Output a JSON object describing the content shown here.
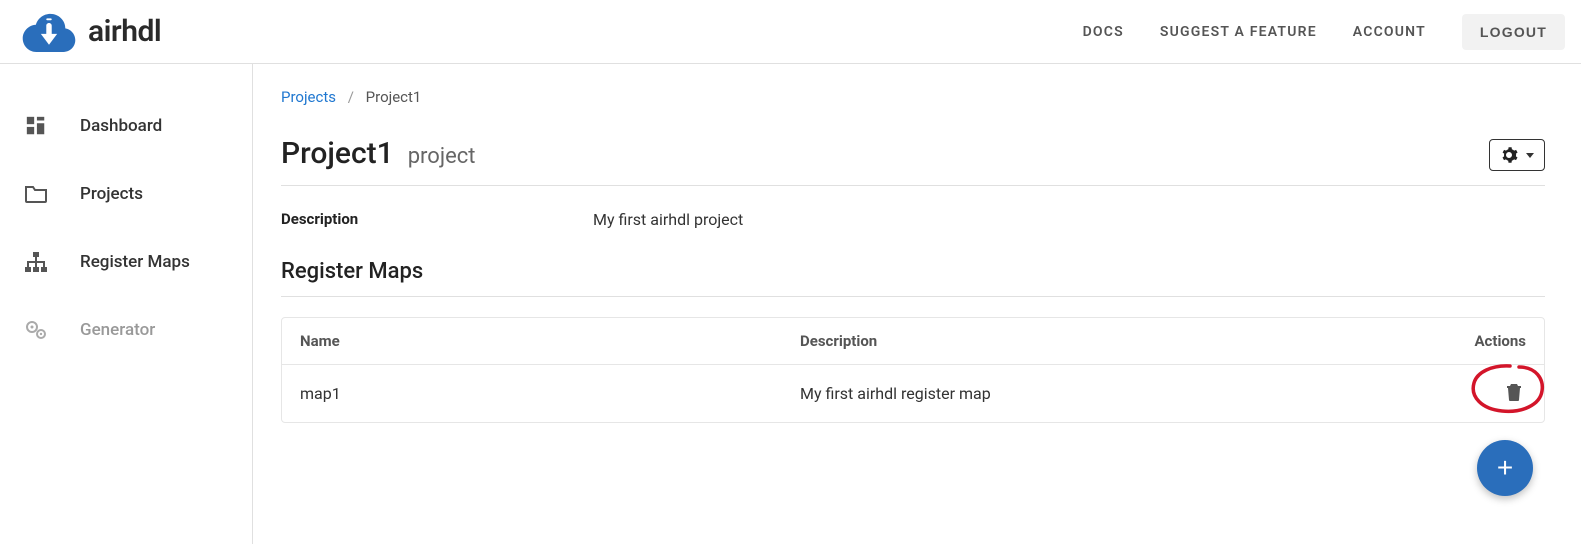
{
  "brand": {
    "name": "airhdl"
  },
  "topnav": {
    "docs": "DOCS",
    "suggest": "SUGGEST A FEATURE",
    "account": "ACCOUNT",
    "logout": "LOGOUT"
  },
  "sidebar": {
    "items": [
      {
        "label": "Dashboard",
        "icon": "dashboard-icon"
      },
      {
        "label": "Projects",
        "icon": "folder-icon"
      },
      {
        "label": "Register Maps",
        "icon": "sitemap-icon"
      },
      {
        "label": "Generator",
        "icon": "gears-icon"
      }
    ]
  },
  "breadcrumb": {
    "root": "Projects",
    "current": "Project1"
  },
  "page": {
    "title": "Project1",
    "subtitle": "project",
    "description_label": "Description",
    "description_value": "My first airhdl project",
    "section_title": "Register Maps"
  },
  "table": {
    "headers": {
      "name": "Name",
      "description": "Description",
      "actions": "Actions"
    },
    "rows": [
      {
        "name": "map1",
        "description": "My first airhdl register map"
      }
    ]
  },
  "fab": {
    "label": "+"
  }
}
